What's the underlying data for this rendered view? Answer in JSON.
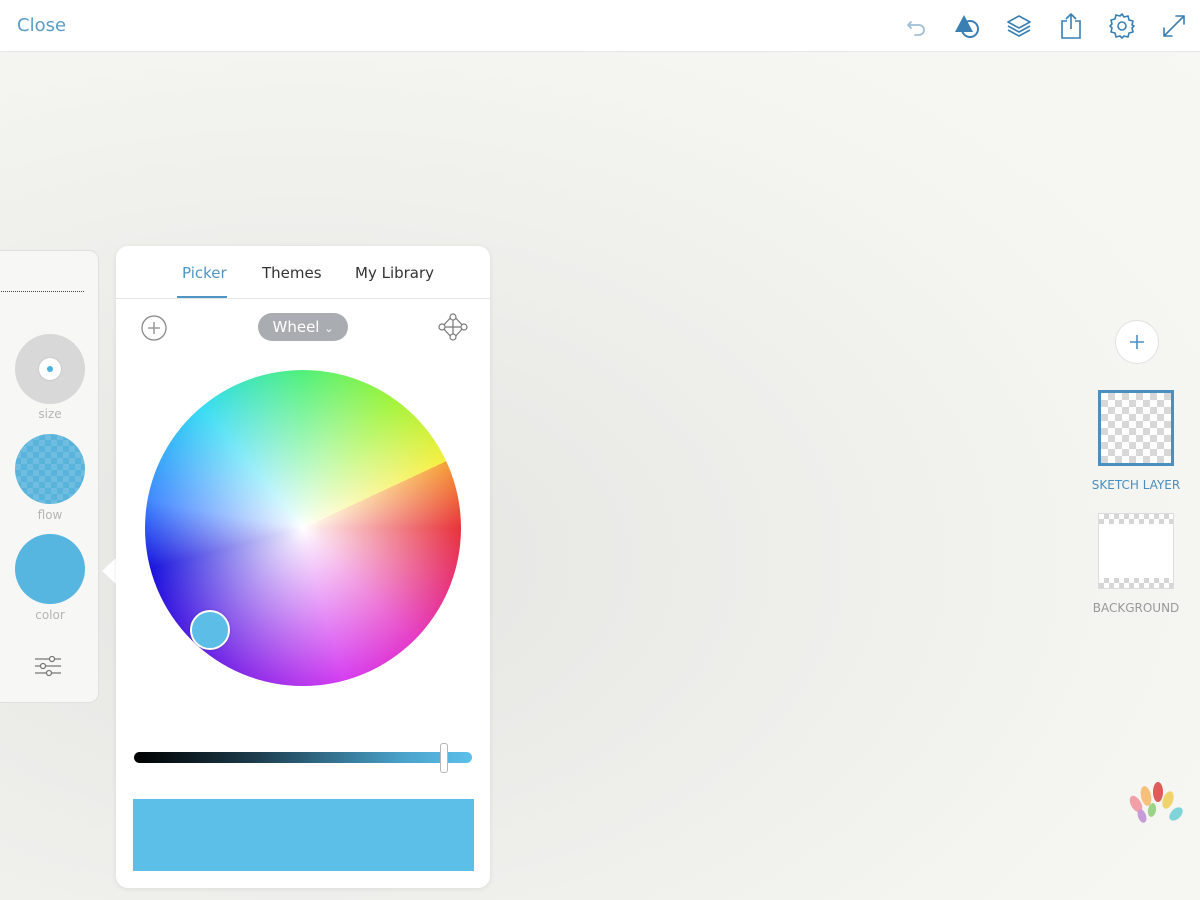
{
  "topbar": {
    "close_label": "Close",
    "icons": [
      "undo-icon",
      "shapes-icon",
      "layers-icon",
      "share-icon",
      "settings-gear-icon",
      "fullscreen-expand-icon"
    ]
  },
  "tool_panel": {
    "size_label": "size",
    "flow_label": "flow",
    "color_label": "color"
  },
  "color_panel": {
    "tabs": [
      "Picker",
      "Themes",
      "My Library"
    ],
    "active_tab": "Picker",
    "mode_label": "Wheel",
    "selected_color": "#5cbfe8",
    "brightness_slider_value": 0.94
  },
  "layers": {
    "sketch_label": "SKETCH LAYER",
    "background_label": "BACKGROUND"
  },
  "colors": {
    "accent": "#4f96c4",
    "dropdown_bg": "#a9adb2"
  }
}
